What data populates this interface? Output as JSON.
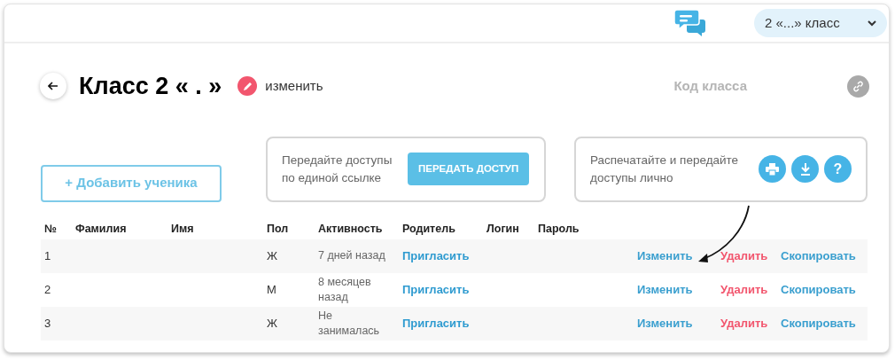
{
  "class_select": {
    "value": "2 «...» класс"
  },
  "title": "Класс 2 « . »",
  "edit_link": "изменить",
  "class_code_label": "Код класса",
  "add_student_button": "+ Добавить ученика",
  "share_card": {
    "text": "Передайте доступы по единой ссылке",
    "button": "ПЕРЕДАТЬ ДОСТУП"
  },
  "print_card": {
    "text": "Распечатайте и передайте доступы лично",
    "help": "?"
  },
  "table": {
    "columns": [
      "№",
      "Фамилия",
      "Имя",
      "Пол",
      "Активность",
      "Родитель",
      "Логин",
      "Пароль"
    ],
    "rows": [
      {
        "number": "1",
        "gender": "Ж",
        "activity": "7 дней назад",
        "parent": "Пригласить",
        "edit": "Изменить",
        "delete": "Удалить",
        "copy": "Скопировать"
      },
      {
        "number": "2",
        "gender": "М",
        "activity": "8 месяцев назад",
        "parent": "Пригласить",
        "edit": "Изменить",
        "delete": "Удалить",
        "copy": "Скопировать"
      },
      {
        "number": "3",
        "gender": "Ж",
        "activity": "Не занималась",
        "parent": "Пригласить",
        "edit": "Изменить",
        "delete": "Удалить",
        "copy": "Скопировать"
      }
    ]
  }
}
